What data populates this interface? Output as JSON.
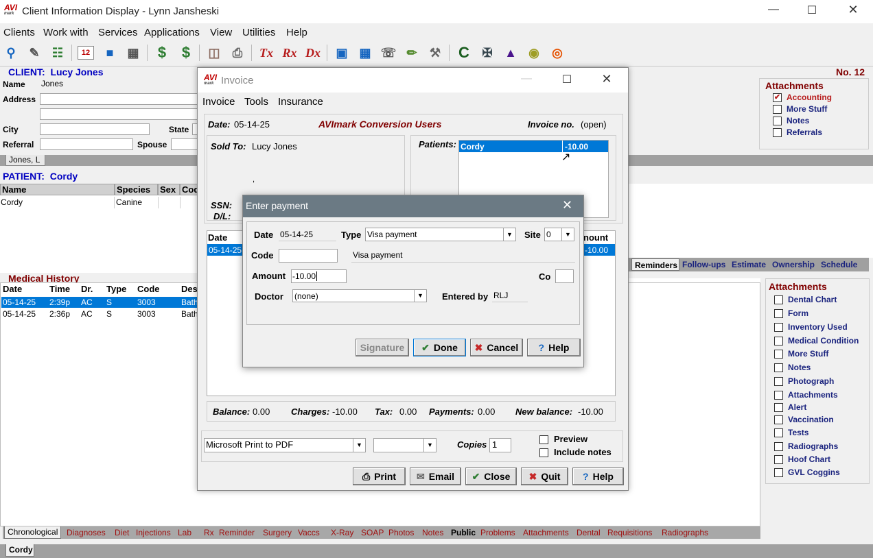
{
  "app": {
    "logo": "AVI",
    "logo_sub": "mark",
    "title": "Client Information Display - Lynn Jansheski",
    "menu": [
      "Clients",
      "Work with",
      "Services",
      "Applications",
      "View",
      "Utilities",
      "Help"
    ]
  },
  "client": {
    "header": "CLIENT:",
    "name_display": "Lucy Jones",
    "number": "No. 12",
    "name_label": "Name",
    "name_value": "Jones",
    "address_label": "Address",
    "city_label": "City",
    "state_label": "State",
    "referral_label": "Referral",
    "spouse_label": "Spouse",
    "tab": "Jones, L"
  },
  "client_attachments": {
    "title": "Attachments",
    "items": [
      {
        "label": "Accounting",
        "checked": "✔"
      },
      {
        "label": "More Stuff",
        "checked": ""
      },
      {
        "label": "Notes",
        "checked": ""
      },
      {
        "label": "Referrals",
        "checked": ""
      }
    ]
  },
  "patient": {
    "header": "PATIENT:",
    "name_display": "Cordy",
    "columns": [
      "Name",
      "Species",
      "Sex",
      "Cod"
    ],
    "row": {
      "name": "Cordy",
      "species": "Canine",
      "sex": "",
      "code": ""
    },
    "bottom_tab": "Cordy"
  },
  "medical_history": {
    "title": "Medical History",
    "columns": [
      "Date",
      "Time",
      "Dr.",
      "Type",
      "Code",
      "Des"
    ],
    "rows": [
      {
        "date": "05-14-25",
        "time": "2:39p",
        "dr": "AC",
        "type": "S",
        "code": "3003",
        "desc": "Bath"
      },
      {
        "date": "05-14-25",
        "time": "2:36p",
        "dr": "AC",
        "type": "S",
        "code": "3003",
        "desc": "Bath"
      }
    ],
    "tabs": [
      "Chronological",
      "Diagnoses",
      "Diet",
      "Injections",
      "Lab",
      "Rx",
      "Reminder",
      "Surgery",
      "Vaccs",
      "X-Ray",
      "SOAP",
      "Photos",
      "Notes",
      "Public",
      "Problems",
      "Attachments",
      "Dental",
      "Requisitions",
      "Radiographs"
    ]
  },
  "patient_tabs": [
    "Reminders",
    "Follow-ups",
    "Estimate",
    "Ownership",
    "Schedule"
  ],
  "patient_attachments": {
    "title": "Attachments",
    "items": [
      "Dental Chart",
      "Form",
      "Inventory Used",
      "Medical Condition",
      "More Stuff",
      "Notes",
      "Photograph",
      "Attachments",
      "Alert",
      "Vaccination",
      "Tests",
      "Radiographs",
      "Hoof Chart",
      "GVL Coggins"
    ]
  },
  "invoice": {
    "title": "Invoice",
    "menu": [
      "Invoice",
      "Tools",
      "Insurance"
    ],
    "date_label": "Date:",
    "date_value": "05-14-25",
    "company": "AVImark Conversion Users",
    "invoice_no_label": "Invoice no.",
    "invoice_no_value": "(open)",
    "sold_to_label": "Sold To:",
    "sold_to_value": "Lucy Jones",
    "comma": ",",
    "ssn_label": "SSN:",
    "dl_label": "D/L:",
    "patients_label": "Patients:",
    "patient_name": "Cordy",
    "patient_amount": "-10.00",
    "grid_date_header": "Date",
    "grid_amount_header": "nount",
    "grid_row_date": "05-14-25",
    "grid_row_amount": "-10.00",
    "balance_label": "Balance:",
    "balance_value": "0.00",
    "charges_label": "Charges:",
    "charges_value": "-10.00",
    "tax_label": "Tax:",
    "tax_value": "0.00",
    "payments_label": "Payments:",
    "payments_value": "0.00",
    "new_balance_label": "New balance:",
    "new_balance_value": "-10.00",
    "printer": "Microsoft Print to PDF",
    "copies_label": "Copies",
    "copies_value": "1",
    "preview_label": "Preview",
    "include_notes_label": "Include notes",
    "buttons": {
      "print": "Print",
      "email": "Email",
      "close": "Close",
      "quit": "Quit",
      "help": "Help"
    }
  },
  "payment": {
    "title": "Enter payment",
    "date_label": "Date",
    "date_value": "05-14-25",
    "type_label": "Type",
    "type_value": "Visa payment",
    "site_label": "Site",
    "site_value": "0",
    "code_label": "Code",
    "code_value": "",
    "description_value": "Visa payment",
    "amount_label": "Amount",
    "amount_value": "-10.00",
    "co_label": "Co",
    "doctor_label": "Doctor",
    "doctor_value": "(none)",
    "entered_by_label": "Entered by",
    "entered_by_value": "RLJ",
    "buttons": {
      "signature": "Signature",
      "done": "Done",
      "cancel": "Cancel",
      "help": "Help"
    }
  },
  "colors": {
    "accent": "#0078d7",
    "client_blue": "#0000c0",
    "maroon": "#800000",
    "tab_red": "#a01010"
  }
}
